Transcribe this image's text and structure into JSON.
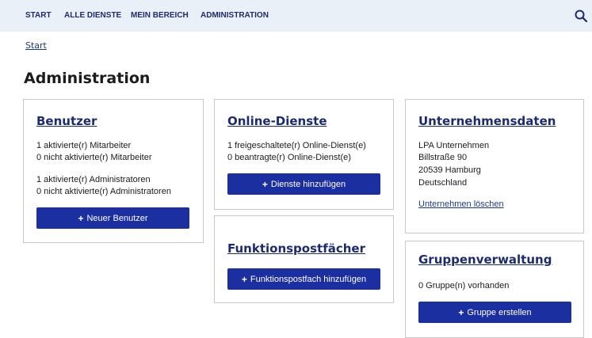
{
  "nav": {
    "items": [
      {
        "label": "START"
      },
      {
        "label": "ALLE DIENSTE"
      },
      {
        "label": "MEIN BEREICH"
      },
      {
        "label": "ADMINISTRATION"
      }
    ],
    "search_icon": "search-icon"
  },
  "breadcrumb": {
    "start": "Start"
  },
  "page": {
    "title": "Administration"
  },
  "colors": {
    "primary": "#1c2fa0",
    "nav_bg": "#eaf0f8",
    "link": "#1c3a8c"
  },
  "cards": {
    "benutzer": {
      "title": "Benutzer",
      "lines": [
        "1 aktivierte(r) Mitarbeiter",
        "0 nicht aktivierte(r) Mitarbeiter",
        "1 aktivierte(r) Administratoren",
        "0 nicht aktivierte(r) Administratoren"
      ],
      "button_label": "Neuer Benutzer"
    },
    "online_dienste": {
      "title": "Online-Dienste",
      "lines": [
        "1 freigeschaltete(r) Online-Dienst(e)",
        "0 beantragte(r) Online-Dienst(e)"
      ],
      "button_label": "Dienste hinzufügen"
    },
    "unternehmensdaten": {
      "title": "Unternehmensdaten",
      "lines": [
        "LPA Unternehmen",
        "Billstraße 90",
        "20539 Hamburg",
        "Deutschland"
      ],
      "link_label": "Unternehmen löschen"
    },
    "funktionspostfaecher": {
      "title": "Funktionspostfächer",
      "button_label": "Funktionspostfach hinzufügen"
    },
    "gruppenverwaltung": {
      "title": "Gruppenverwaltung",
      "lines": [
        "0 Gruppe(n) vorhanden"
      ],
      "button_label": "Gruppe erstellen"
    }
  }
}
